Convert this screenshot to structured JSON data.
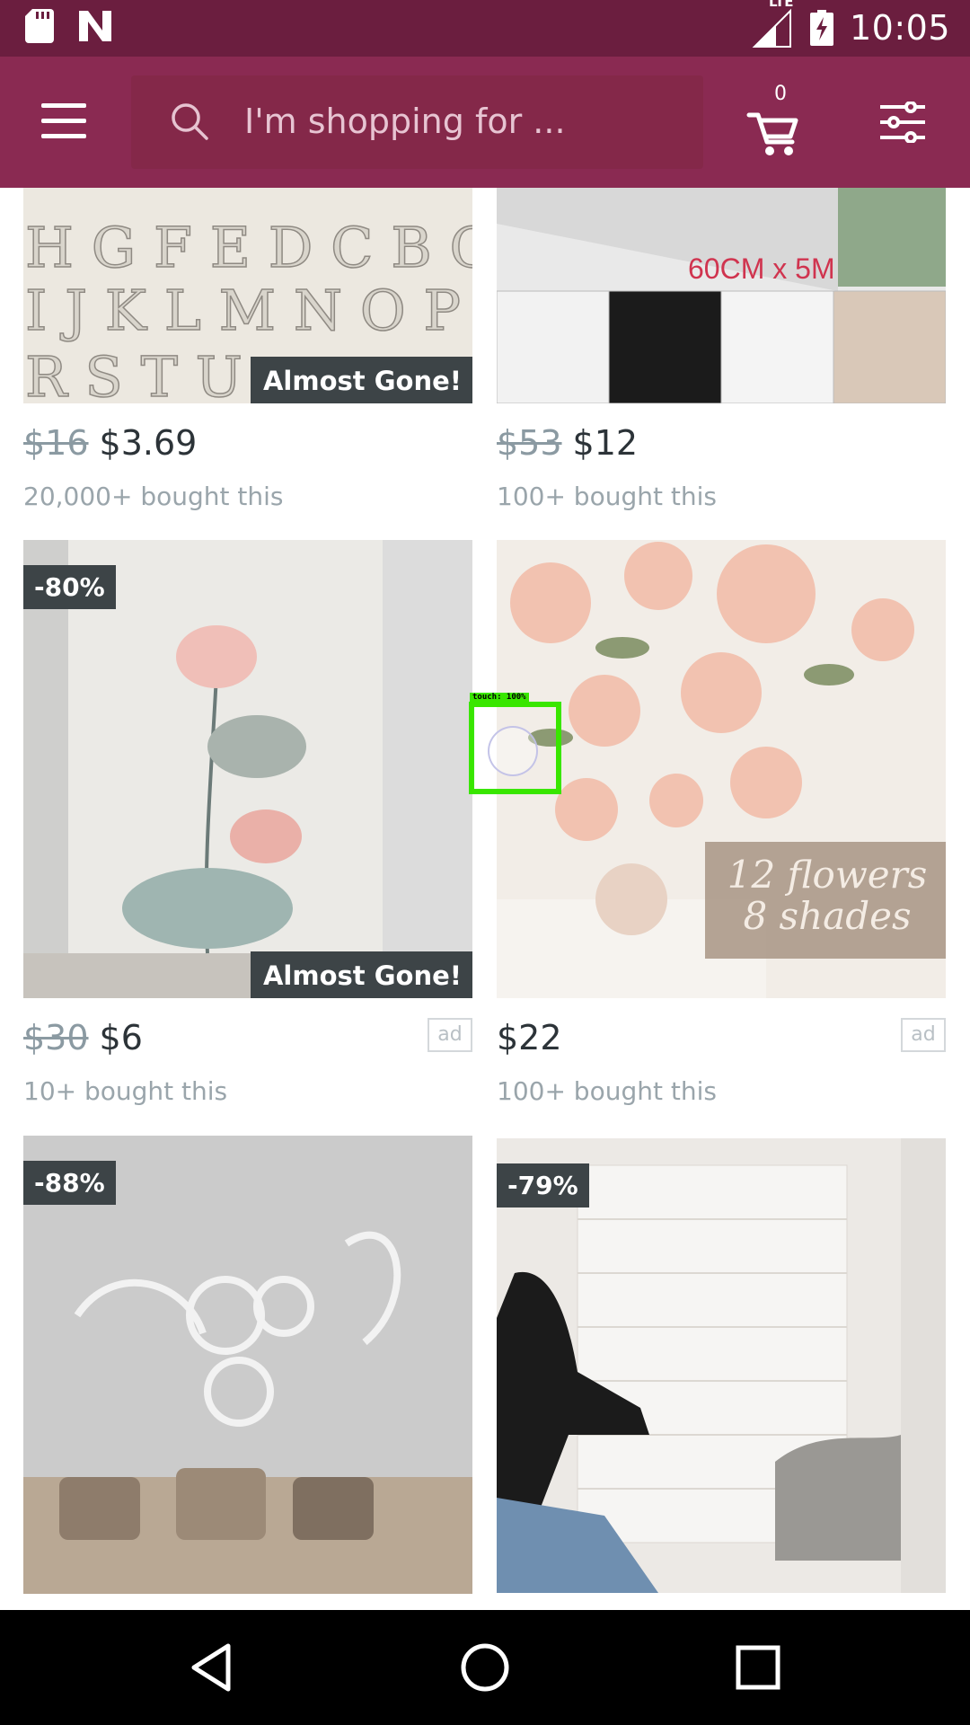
{
  "status_bar": {
    "time": "10:05",
    "network": "LTE"
  },
  "search": {
    "placeholder": "I'm shopping for ..."
  },
  "cart": {
    "count": "0"
  },
  "products": [
    {
      "old_price": "$16",
      "price": "$3.69",
      "bought": "20,000+ bought this",
      "badge": "Almost Gone!",
      "discount": "",
      "ad": "",
      "image": "3D letter wall stickers"
    },
    {
      "old_price": "$53",
      "price": "$12",
      "bought": "100+ bought this",
      "badge": "",
      "discount": "",
      "ad": "",
      "image_caption": "60CM x 5M"
    },
    {
      "old_price": "$30",
      "price": "$6",
      "bought": "10+ bought this",
      "badge": "Almost Gone!",
      "discount": "-80%",
      "ad": "ad",
      "image": "lotus wall decal"
    },
    {
      "old_price": "",
      "price": "$22",
      "bought": "100+ bought this",
      "badge": "",
      "discount": "",
      "ad": "ad",
      "image_caption": "12 flowers 8 shades"
    },
    {
      "discount": "-88%",
      "image": "mirror flower wall sticker"
    },
    {
      "discount": "-79%",
      "image": "3D brick foam wall panel"
    }
  ],
  "touch": {
    "label": "touch: 100%"
  },
  "colors": {
    "status_bar": "#6b1e3f",
    "app_bar": "#8a2a52",
    "badge": "#3d4447"
  }
}
